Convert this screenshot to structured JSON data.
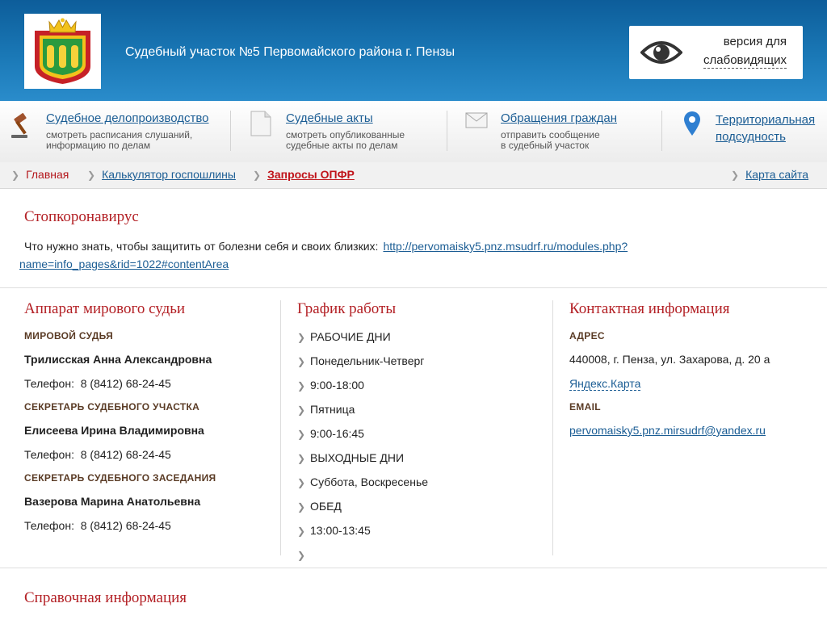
{
  "header": {
    "title": "Судебный участок №5 Первомайского района г. Пензы",
    "logo_icon": "coat-of-arms-icon",
    "vision": {
      "line1": "версия для",
      "line2": "слабовидящих",
      "icon": "eye-icon"
    }
  },
  "services": [
    {
      "title": "Судебное делопроизводство",
      "desc1": "смотреть расписания слушаний,",
      "desc2": "информацию по делам",
      "icon": "gavel-icon"
    },
    {
      "title": "Судебные акты",
      "desc1": "смотреть опубликованные",
      "desc2": "судебные акты по делам",
      "icon": "document-icon"
    },
    {
      "title": "Обращения граждан",
      "desc1": "отправить сообщение",
      "desc2": "в судебный участок",
      "icon": "envelope-icon"
    },
    {
      "title1": "Территориальная",
      "title2": "подсудность",
      "icon": "map-pin-icon"
    }
  ],
  "breadcrumb": {
    "home": "Главная",
    "calculator": "Калькулятор госпошлины",
    "current": "Запросы ОПФР",
    "sitemap": "Карта сайта"
  },
  "covid": {
    "title": "Стопкоронавирус",
    "text": "Что нужно знать, чтобы защитить от болезни себя и своих близких:",
    "link_line1": "http://pervomaisky5.pnz.msudrf.ru/modules.php?",
    "link_line2": "name=info_pages&rid=1022#contentArea"
  },
  "staff": {
    "title": "Аппарат мирового судьи",
    "phone_label": "Телефон:",
    "people": [
      {
        "role": "МИРОВОЙ СУДЬЯ",
        "name": "Трилисская Анна Александровна",
        "phone": "8 (8412) 68-24-45"
      },
      {
        "role": "СЕКРЕТАРЬ СУДЕБНОГО УЧАСТКА",
        "name": "Елисеева Ирина Владимировна",
        "phone": "8 (8412) 68-24-45"
      },
      {
        "role": "СЕКРЕТАРЬ СУДЕБНОГО ЗАСЕДАНИЯ",
        "name": "Вазерова Марина Анатольевна",
        "phone": "8 (8412) 68-24-45"
      }
    ]
  },
  "schedule": {
    "title": "График работы",
    "items": [
      "РАБОЧИЕ ДНИ",
      "Понедельник-Четверг",
      "9:00-18:00",
      "Пятница",
      "9:00-16:45",
      "ВЫХОДНЫЕ ДНИ",
      "Суббота, Воскресенье",
      "ОБЕД",
      "13:00-13:45",
      ""
    ]
  },
  "contacts": {
    "title": "Контактная информация",
    "address_label": "АДРЕС",
    "address": "440008, г. Пенза, ул. Захарова, д. 20 а",
    "map_link": "Яндекс.Карта",
    "email_label": "EMAIL",
    "email": "pervomaisky5.pnz.mirsudrf@yandex.ru"
  },
  "reference": {
    "title": "Справочная информация"
  },
  "colors": {
    "header_blue": "#1a78b6",
    "accent_red": "#b32025",
    "link_blue": "#1b5d94"
  }
}
